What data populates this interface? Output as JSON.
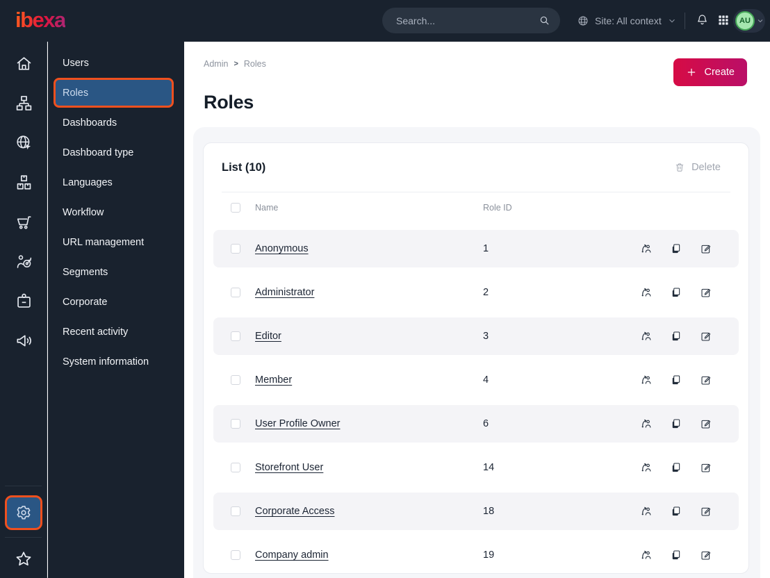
{
  "topbar": {
    "logo_text": "ibexa",
    "search_placeholder": "Search...",
    "site_label": "Site: All context",
    "avatar_initials": "AU",
    "icons": [
      "search-icon",
      "globe-icon",
      "chevron-down-icon",
      "bell-icon",
      "app-grid-icon"
    ]
  },
  "icon_rail": {
    "icons": [
      "home-icon",
      "content-tree-icon",
      "site-globe-icon",
      "packages-icon",
      "cart-icon",
      "audience-target-icon",
      "id-badge-icon",
      "megaphone-icon",
      "settings-gear-icon",
      "star-icon"
    ],
    "active_icon": "settings-gear-icon"
  },
  "sidebar": {
    "items": [
      {
        "label": "Users",
        "active": false
      },
      {
        "label": "Roles",
        "active": true
      },
      {
        "label": "Dashboards",
        "active": false
      },
      {
        "label": "Dashboard type",
        "active": false
      },
      {
        "label": "Languages",
        "active": false
      },
      {
        "label": "Workflow",
        "active": false
      },
      {
        "label": "URL management",
        "active": false
      },
      {
        "label": "Segments",
        "active": false
      },
      {
        "label": "Corporate",
        "active": false
      },
      {
        "label": "Recent activity",
        "active": false
      },
      {
        "label": "System information",
        "active": false
      }
    ]
  },
  "breadcrumb": {
    "items": [
      "Admin",
      "Roles"
    ],
    "separator": ">"
  },
  "page": {
    "title": "Roles",
    "create_label": "Create"
  },
  "list": {
    "title": "List (10)",
    "delete_label": "Delete",
    "columns": [
      "Name",
      "Role ID"
    ],
    "row_action_icons": [
      "assign-user-icon",
      "copy-icon",
      "edit-icon"
    ],
    "rows": [
      {
        "name": "Anonymous",
        "role_id": "1"
      },
      {
        "name": "Administrator",
        "role_id": "2"
      },
      {
        "name": "Editor",
        "role_id": "3"
      },
      {
        "name": "Member",
        "role_id": "4"
      },
      {
        "name": "User Profile Owner",
        "role_id": "6"
      },
      {
        "name": "Storefront User",
        "role_id": "14"
      },
      {
        "name": "Corporate Access",
        "role_id": "18"
      },
      {
        "name": "Company admin",
        "role_id": "19"
      }
    ]
  },
  "colors": {
    "topbar_bg": "#19222e",
    "accent_orange": "#f0501e",
    "active_blue": "#2a5684",
    "create_gradient_start": "#d60b45",
    "create_gradient_end": "#ba0f67",
    "avatar_green": "#a5e7af",
    "row_alt_bg": "#f4f4f7"
  }
}
